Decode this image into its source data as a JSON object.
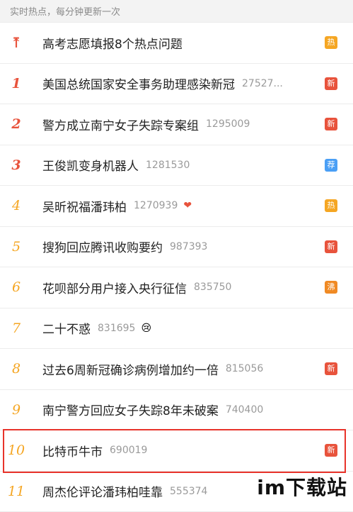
{
  "header": {
    "text": "实时热点，每分钟更新一次"
  },
  "colors": {
    "hot": "#f5a623",
    "new": "#e8533c",
    "rec": "#4a9ff5",
    "boil": "#f08a24",
    "highlight": "#e8332a"
  },
  "items": [
    {
      "rank": "",
      "title": "高考志愿填报8个热点问题",
      "count": "",
      "badge": "热",
      "badge_type": "hot",
      "icon": "pin-top-icon"
    },
    {
      "rank": "1",
      "title": "美国总统国家安全事务助理感染新冠",
      "count": "27527...",
      "badge": "新",
      "badge_type": "new"
    },
    {
      "rank": "2",
      "title": "警方成立南宁女子失踪专案组",
      "count": "1295009",
      "badge": "新",
      "badge_type": "new"
    },
    {
      "rank": "3",
      "title": "王俊凯变身机器人",
      "count": "1281530",
      "badge": "荐",
      "badge_type": "rec"
    },
    {
      "rank": "4",
      "title": "吴昕祝福潘玮柏",
      "count": "1270939",
      "emoji": "❤",
      "emoji_name": "heart-icon",
      "badge": "热",
      "badge_type": "hot"
    },
    {
      "rank": "5",
      "title": "搜狗回应腾讯收购要约",
      "count": "987393",
      "badge": "新",
      "badge_type": "new"
    },
    {
      "rank": "6",
      "title": "花呗部分用户接入央行征信",
      "count": "835750",
      "badge": "沸",
      "badge_type": "boil"
    },
    {
      "rank": "7",
      "title": "二十不惑",
      "count": "831695",
      "emoji": "😢",
      "emoji_name": "crying-face-icon",
      "badge": "",
      "badge_type": ""
    },
    {
      "rank": "8",
      "title": "过去6周新冠确诊病例增加约一倍",
      "count": "815056",
      "badge": "新",
      "badge_type": "new"
    },
    {
      "rank": "9",
      "title": "南宁警方回应女子失踪8年未破案",
      "count": "740400",
      "badge": "",
      "badge_type": ""
    },
    {
      "rank": "10",
      "title": "比特币牛市",
      "count": "690019",
      "badge": "新",
      "badge_type": "new",
      "highlighted": true
    },
    {
      "rank": "11",
      "title": "周杰伦评论潘玮柏哇靠",
      "count": "555374",
      "badge": "",
      "badge_type": ""
    }
  ],
  "watermark": {
    "text": "im下载站"
  }
}
